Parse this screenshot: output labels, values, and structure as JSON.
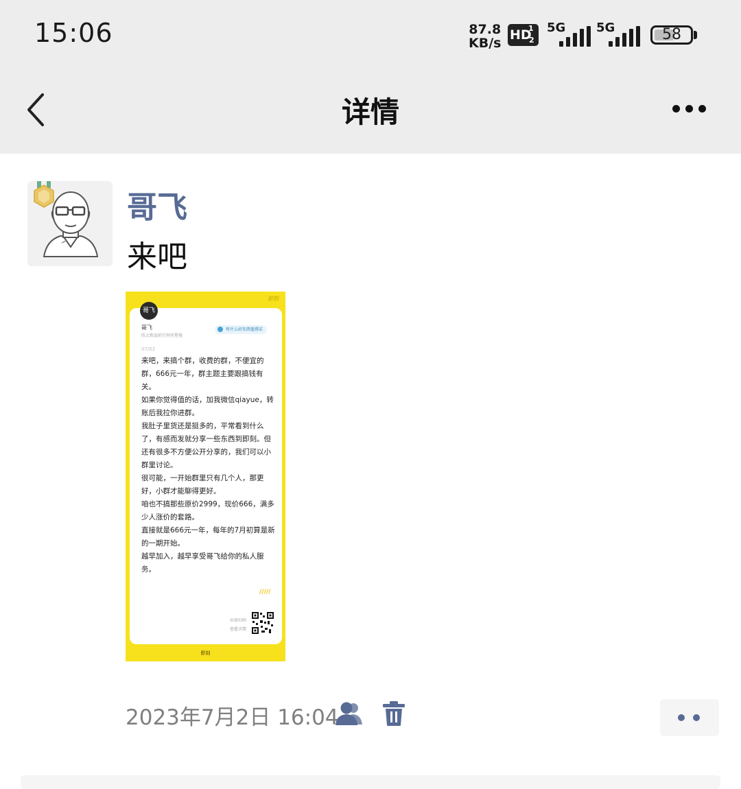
{
  "status_bar": {
    "time": "15:06",
    "net_speed_value": "87.8",
    "net_speed_unit": "KB/s",
    "hd_label": "HD",
    "hd_sup": "1",
    "hd_sub": "2",
    "sim1_label": "5G",
    "sim2_label": "5G",
    "battery": "58"
  },
  "nav": {
    "title": "详情",
    "back_icon": "chevron-left-icon",
    "more_icon": "more-dots-icon"
  },
  "post": {
    "username": "哥飞",
    "text": "来吧",
    "avatar_icon": "bald-man-glasses-avatar",
    "badge_icon": "medal-badge-icon",
    "time": "2023年7月2日 16:04",
    "visibility_icon": "people-icon",
    "delete_icon": "trash-icon",
    "action_icon": "two-dots-icon",
    "colors": {
      "link": "#576b95",
      "image_bg": "#f7e11d"
    }
  },
  "image_card": {
    "brand": "即刻",
    "avatar_text": "哥飞",
    "name": "哥飞",
    "subtitle": "防止新品前行有所星悔",
    "pill": "有什么好东西值得买",
    "date": "07/02",
    "body": "来吧，来搞个群，收费的群，不便宜的群，666元一年，群主题主要跟搞钱有关。\n如果你觉得值的话，加我微信qiayue，转账后我拉你进群。\n我肚子里货还是挺多的，平常看到什么了，有感而发就分享一些东西到即刻。但还有很多不方便公开分享的，我们可以小群里讨论。\n很可能，一开始群里只有几个人，那更好，小群才能聊得更好。\n咱也不搞那些原价2999，现价666，满多少人涨价的套路。\n直接就是666元一年，每年的7月初算是新的一期开始。\n越早加入，越早享受哥飞给你的私人服务。",
    "slash": "/////",
    "qr_tip": "长按扫码\n查看详情",
    "qr_icon": "qr-code-icon"
  }
}
